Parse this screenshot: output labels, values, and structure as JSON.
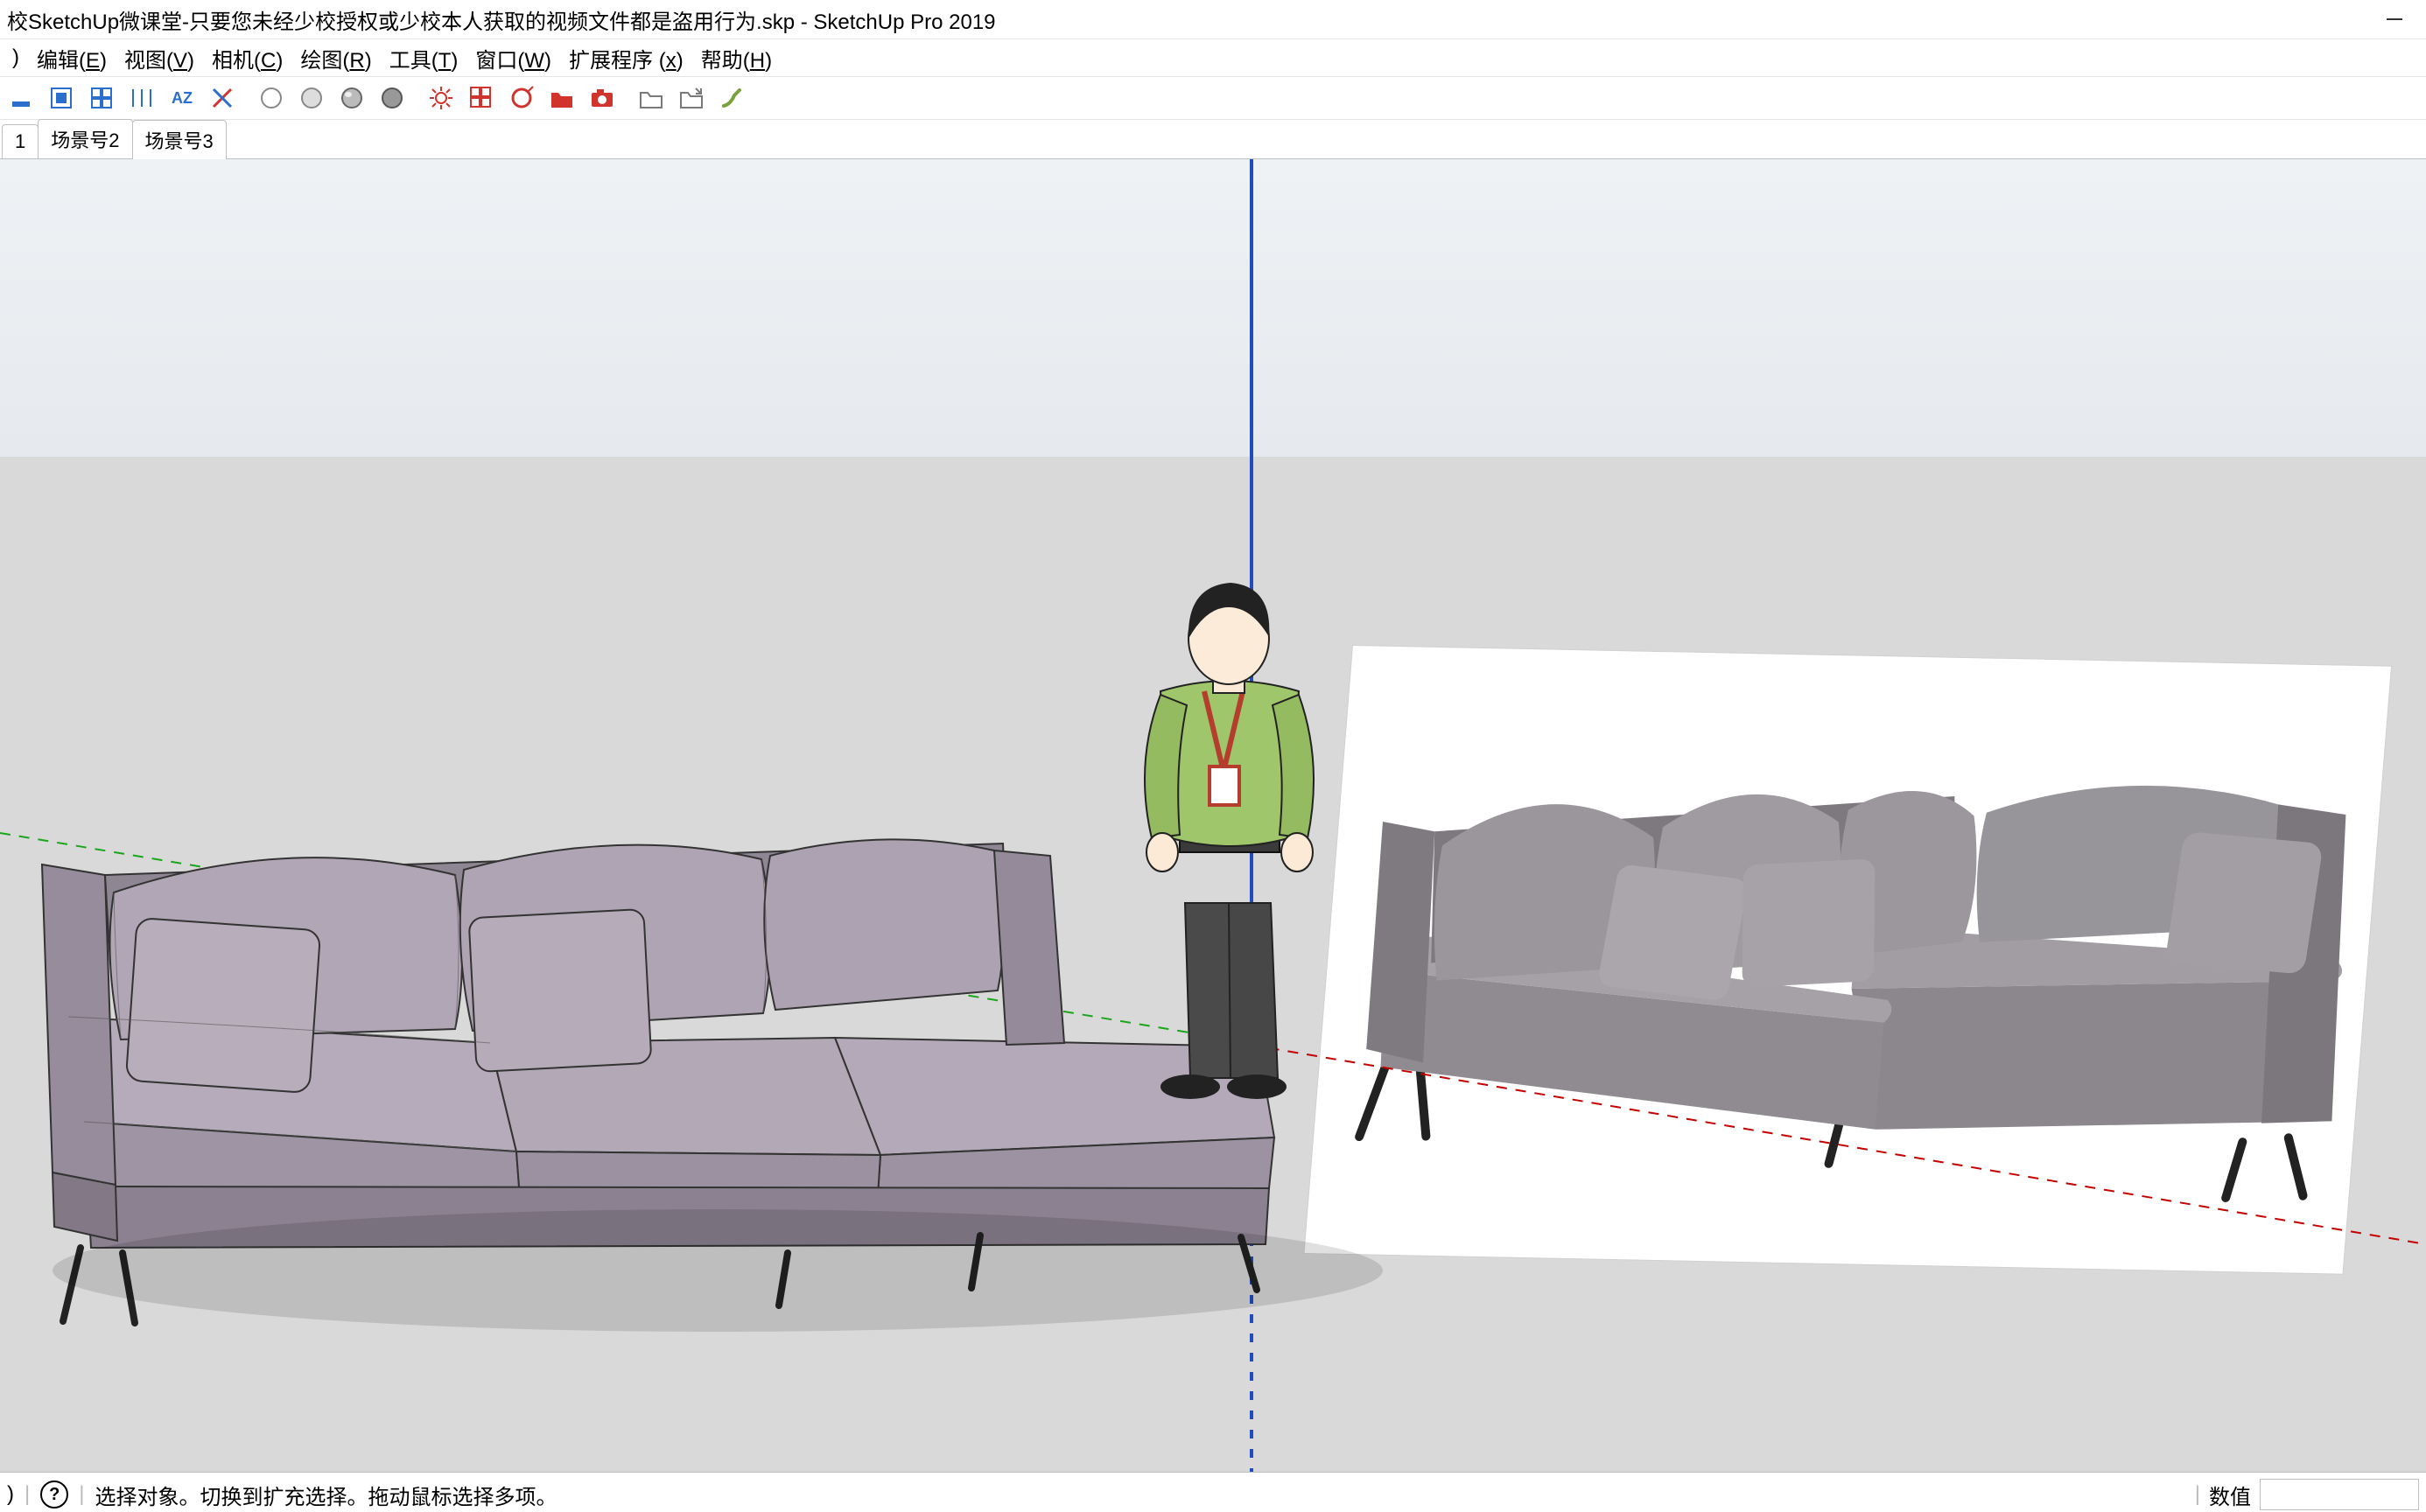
{
  "app": {
    "title": "校SketchUp微课堂-只要您未经少校授权或少校本人获取的视频文件都是盗用行为.skp - SketchUp Pro 2019"
  },
  "menu": {
    "items": [
      {
        "label": "编辑",
        "key": "E"
      },
      {
        "label": "视图",
        "key": "V"
      },
      {
        "label": "相机",
        "key": "C"
      },
      {
        "label": "绘图",
        "key": "R"
      },
      {
        "label": "工具",
        "key": "T"
      },
      {
        "label": "窗口",
        "key": "W"
      },
      {
        "label": "扩展程序",
        "key": "x"
      },
      {
        "label": "帮助",
        "key": "H"
      }
    ]
  },
  "toolbar": {
    "icons": [
      "draw-rectangle",
      "components",
      "grid",
      "dimension",
      "text-size",
      "axis",
      "sep",
      "wireframe",
      "hidden-line",
      "shaded",
      "monochrome",
      "sep",
      "component-options-red",
      "make-component",
      "orbit",
      "folder-red",
      "camera-red",
      "sep",
      "open-folder",
      "export",
      "paintbrush"
    ]
  },
  "tabs": {
    "items": [
      "1",
      "场景号2",
      "场景号3"
    ],
    "active_index": 2
  },
  "status": {
    "hint": "选择对象。切换到扩充选择。拖动鼠标选择多项。",
    "value_label": "数值"
  },
  "scene": {
    "axes": {
      "blue": "#1f4dbf",
      "green": "#1aa61a",
      "red": "#c40000"
    },
    "objects": [
      "sofa-3d-model",
      "scale-figure",
      "reference-image-sofa"
    ]
  }
}
